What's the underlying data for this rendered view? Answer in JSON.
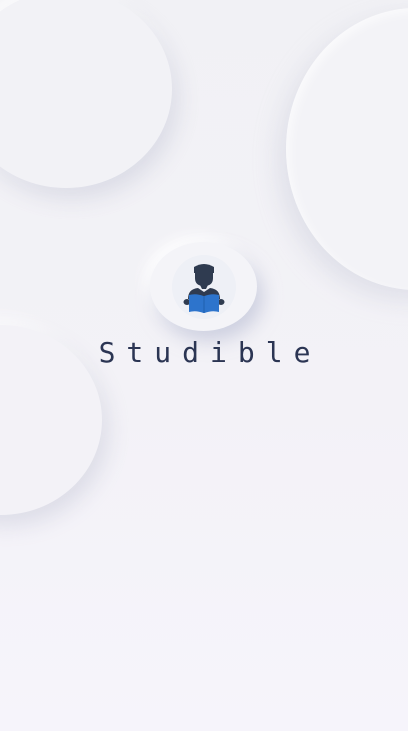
{
  "app": {
    "name": "Studible"
  },
  "logo": {
    "icon": "student-reading-book-icon",
    "colors": {
      "figure": "#2f3b50",
      "book": "#2d74cc",
      "book_dark": "#1f5fae"
    }
  },
  "colors": {
    "background": "#f2f2f6",
    "title_text": "#2b3553"
  }
}
